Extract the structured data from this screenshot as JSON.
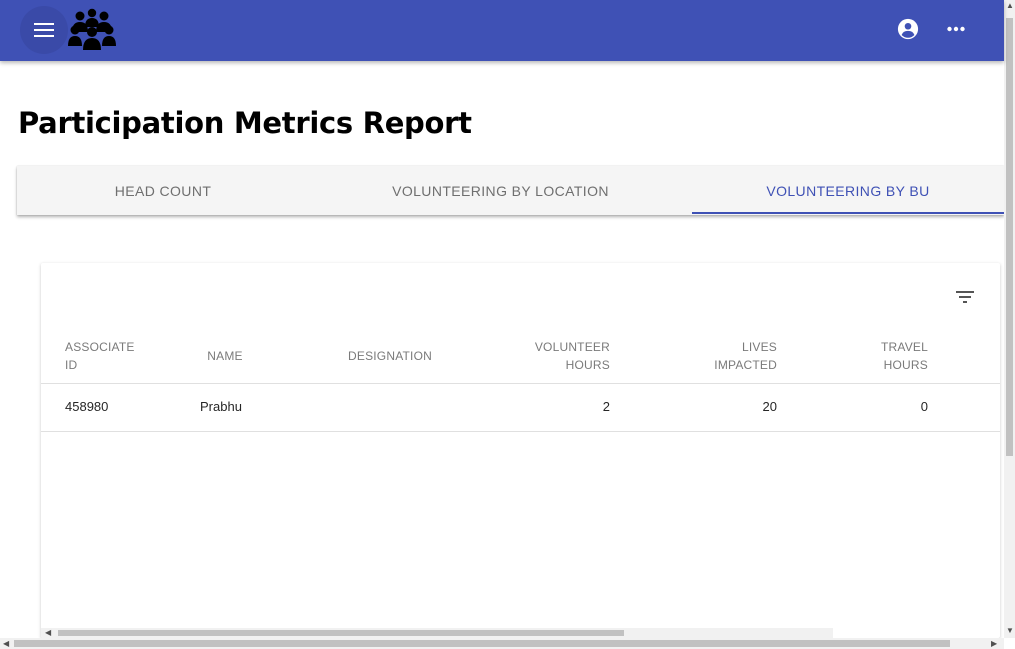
{
  "app": {
    "colors": {
      "primary": "#3f51b5",
      "tab_background": "#f5f5f5"
    },
    "icons": {
      "menu": "hamburger-menu-icon",
      "logo": "people-group-logo",
      "account": "account-circle-icon",
      "more": "more-horizontal-icon",
      "filter": "filter-list-icon"
    }
  },
  "page": {
    "title": "Participation Metrics Report"
  },
  "tabs": [
    {
      "label": "HEAD COUNT",
      "active": false
    },
    {
      "label": "VOLUNTEERING BY LOCATION",
      "active": false
    },
    {
      "label": "VOLUNTEERING BY BU",
      "active": true
    }
  ],
  "table": {
    "columns": [
      {
        "line1": "ASSOCIATE",
        "line2": "ID"
      },
      {
        "line1": "NAME",
        "line2": ""
      },
      {
        "line1": "DESIGNATION",
        "line2": ""
      },
      {
        "line1": "VOLUNTEER",
        "line2": "HOURS"
      },
      {
        "line1": "LIVES",
        "line2": "IMPACTED"
      },
      {
        "line1": "TRAVEL",
        "line2": "HOURS"
      }
    ],
    "rows": [
      {
        "associate_id": "458980",
        "name": "Prabhu",
        "designation": "",
        "volunteer_hours": "2",
        "lives_impacted": "20",
        "travel_hours": "0"
      }
    ]
  }
}
